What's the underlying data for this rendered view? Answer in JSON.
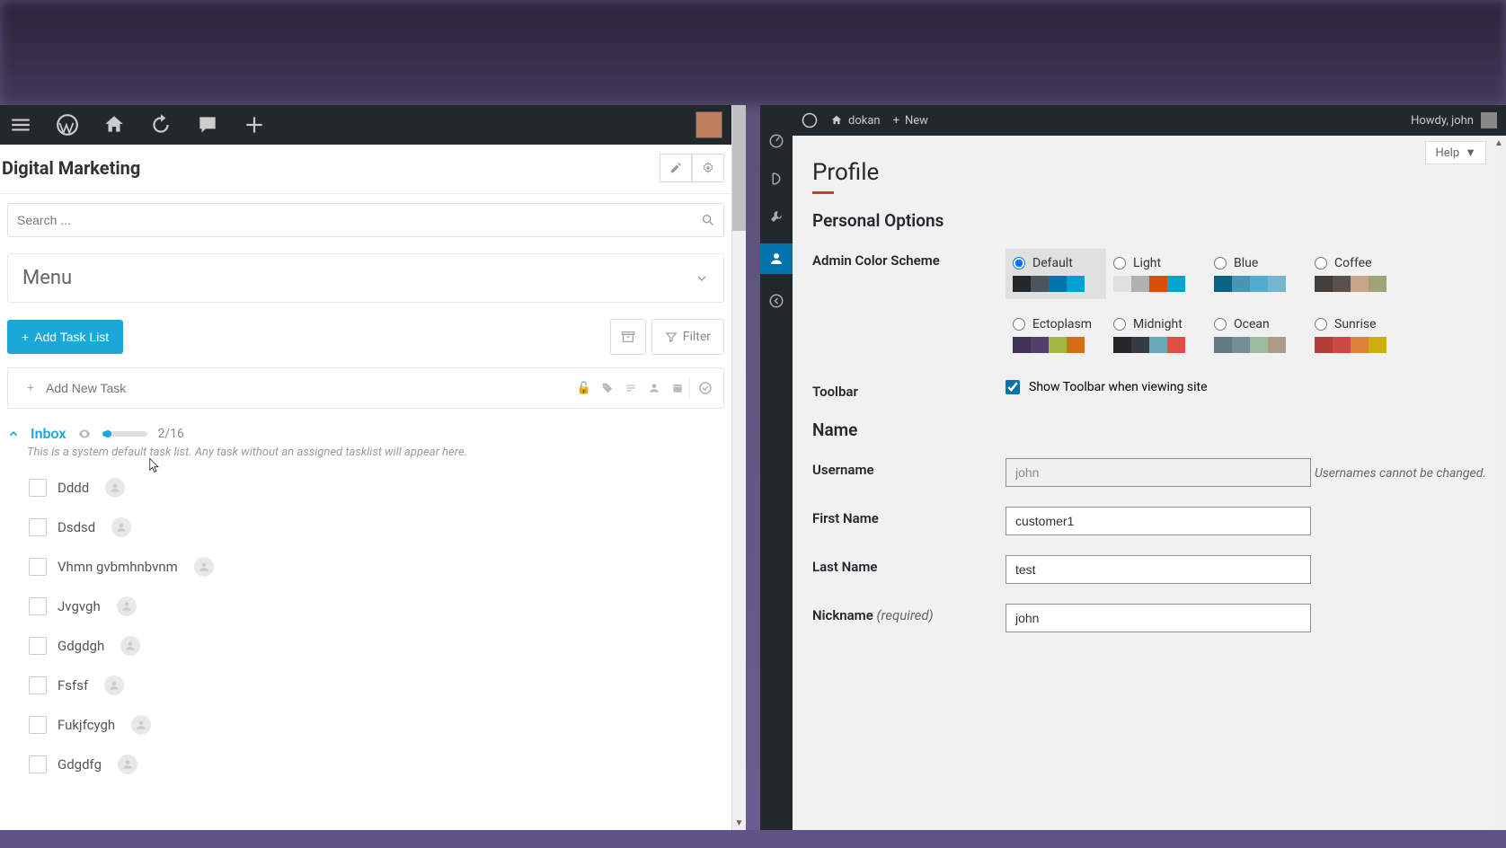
{
  "left": {
    "project_title": "Digital Marketing",
    "search_placeholder": "Search ...",
    "menu_label": "Menu",
    "add_task_list": "Add Task List",
    "filter": "Filter",
    "new_task_placeholder": "Add New Task",
    "inbox": {
      "title": "Inbox",
      "count": "2/16",
      "description": "This is a system default task list. Any task without an assigned tasklist will appear here."
    },
    "tasks": [
      {
        "name": "Dddd"
      },
      {
        "name": "Dsdsd"
      },
      {
        "name": "Vhmn gvbmhnbvnm"
      },
      {
        "name": "Jvgvgh"
      },
      {
        "name": "Gdgdgh"
      },
      {
        "name": "Fsfsf"
      },
      {
        "name": "Fukjfcygh"
      },
      {
        "name": "Gdgdfg"
      }
    ]
  },
  "right": {
    "site_name": "dokan",
    "new_label": "New",
    "greeting": "Howdy, john",
    "help": "Help",
    "page_title": "Profile",
    "section_personal": "Personal Options",
    "section_name": "Name",
    "labels": {
      "color_scheme": "Admin Color Scheme",
      "toolbar": "Toolbar",
      "toolbar_text": "Show Toolbar when viewing site",
      "username": "Username",
      "username_hint": "Usernames cannot be changed.",
      "first_name": "First Name",
      "last_name": "Last Name",
      "nickname": "Nickname",
      "required": "(required)"
    },
    "values": {
      "username": "john",
      "first_name": "customer1",
      "last_name": "test",
      "nickname": "john"
    },
    "color_schemes": [
      {
        "name": "Default",
        "selected": true,
        "colors": [
          "#23282d",
          "#4b5559",
          "#0073aa",
          "#00a0d2"
        ]
      },
      {
        "name": "Light",
        "selected": false,
        "colors": [
          "#e0e0e0",
          "#b0b0b0",
          "#d64e07",
          "#04a4cc"
        ]
      },
      {
        "name": "Blue",
        "selected": false,
        "colors": [
          "#096484",
          "#4796b3",
          "#52accc",
          "#74B6CE"
        ]
      },
      {
        "name": "Coffee",
        "selected": false,
        "colors": [
          "#46403c",
          "#59524c",
          "#c7a589",
          "#9ea476"
        ]
      },
      {
        "name": "Ectoplasm",
        "selected": false,
        "colors": [
          "#413256",
          "#523f6d",
          "#a3b745",
          "#d46f15"
        ]
      },
      {
        "name": "Midnight",
        "selected": false,
        "colors": [
          "#25282b",
          "#363b3f",
          "#69a8bb",
          "#e14d43"
        ]
      },
      {
        "name": "Ocean",
        "selected": false,
        "colors": [
          "#627c83",
          "#738e96",
          "#9ebaa0",
          "#aa9d88"
        ]
      },
      {
        "name": "Sunrise",
        "selected": false,
        "colors": [
          "#b43c38",
          "#cf4944",
          "#dd823b",
          "#ccaf0b"
        ]
      }
    ]
  }
}
